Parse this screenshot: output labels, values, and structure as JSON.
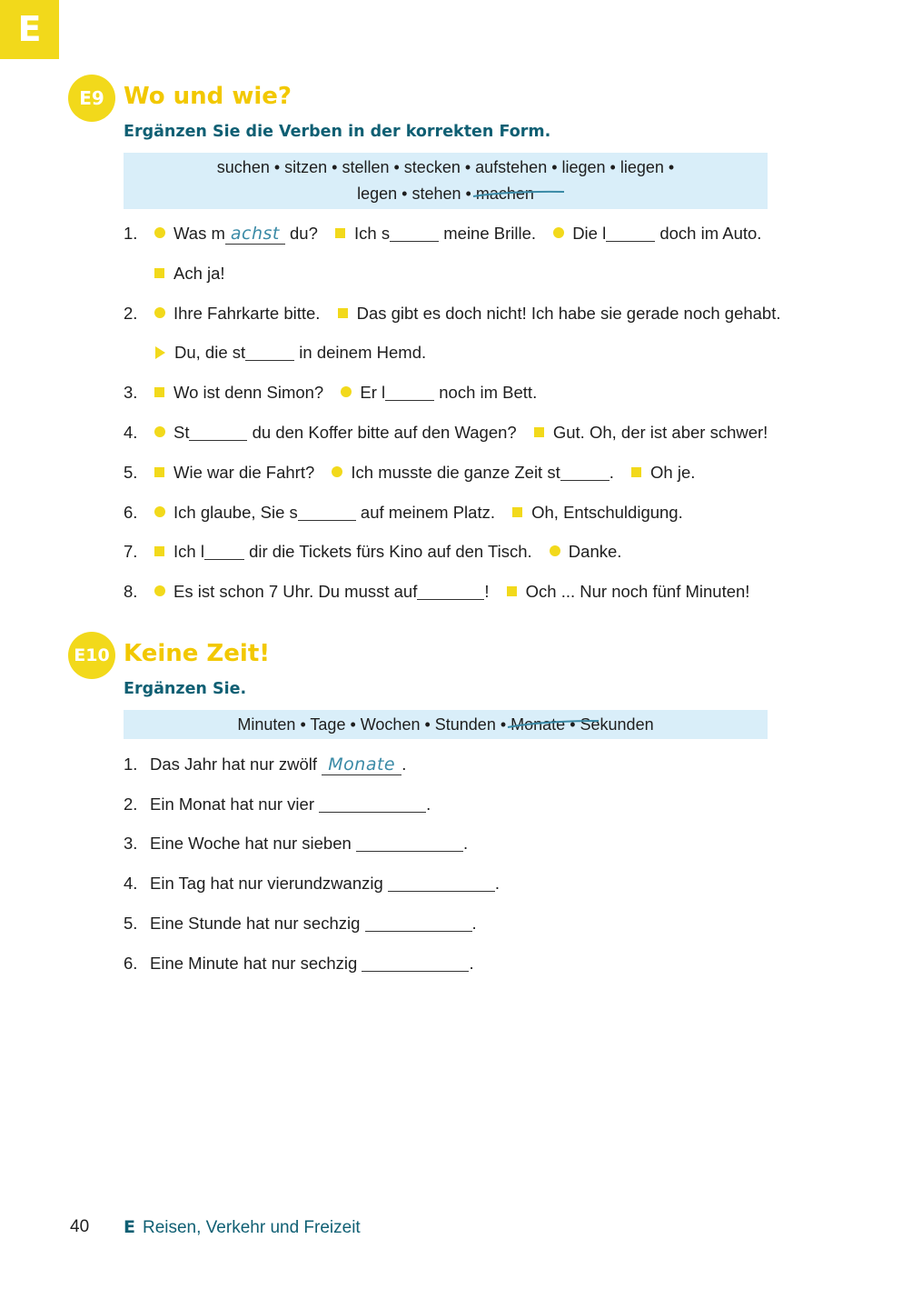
{
  "chapter_letter": "E",
  "e9": {
    "badge": "E9",
    "title": "Wo und wie?",
    "instruction": "Ergänzen Sie die Verben in der korrekten Form.",
    "wordbox_line1": "suchen • sitzen • stellen • stecken • aufstehen • liegen • liegen •",
    "wordbox_line2": "legen • stehen •",
    "wordbox_struck": "machen",
    "items": [
      {
        "num": "1.",
        "a": "Was m",
        "fill": "achst",
        "b": " du?",
        "c": "Ich s",
        "d": " meine Brille.",
        "e": "Die l",
        "f": " doch im Auto."
      },
      {
        "cont": "Ach ja!"
      },
      {
        "num": "2.",
        "a": "Ihre Fahrkarte bitte.",
        "c": "Das gibt es doch nicht! Ich habe sie gerade noch gehabt."
      },
      {
        "a": "Du, die st",
        "b": " in deinem Hemd."
      },
      {
        "num": "3.",
        "a": "Wo ist denn Simon?",
        "c": "Er l",
        "d": " noch im Bett."
      },
      {
        "num": "4.",
        "a": "St",
        "b": " du den Koffer bitte auf den Wagen?",
        "c": "Gut. Oh, der ist aber schwer!"
      },
      {
        "num": "5.",
        "a": "Wie war die Fahrt?",
        "c": "Ich musste die ganze Zeit st",
        "d": ".",
        "e": "Oh je."
      },
      {
        "num": "6.",
        "a": "Ich glaube, Sie s",
        "b": " auf meinem Platz.",
        "c": "Oh, Entschuldigung."
      },
      {
        "num": "7.",
        "a": "Ich l",
        "b": " dir die Tickets fürs Kino auf den Tisch.",
        "c": "Danke."
      },
      {
        "num": "8.",
        "a": "Es ist schon 7 Uhr. Du musst auf",
        "b": "!",
        "c": "Och ... Nur noch fünf Minuten!"
      }
    ]
  },
  "e10": {
    "badge": "E10",
    "title": "Keine Zeit!",
    "instruction": "Ergänzen Sie.",
    "wordbox_before": "Minuten • Tage • Wochen • Stunden •",
    "wordbox_struck": "Monate",
    "wordbox_after": "• Sekunden",
    "items": [
      {
        "num": "1.",
        "text": "Das Jahr hat nur zwölf",
        "fill": "Monate",
        "end": "."
      },
      {
        "num": "2.",
        "text": "Ein Monat hat nur vier",
        "end": "."
      },
      {
        "num": "3.",
        "text": "Eine Woche hat nur sieben",
        "end": "."
      },
      {
        "num": "4.",
        "text": "Ein Tag hat nur vierundzwanzig",
        "end": "."
      },
      {
        "num": "5.",
        "text": "Eine Stunde hat nur sechzig",
        "end": "."
      },
      {
        "num": "6.",
        "text": "Eine Minute hat nur sechzig",
        "end": "."
      }
    ]
  },
  "footer": {
    "page_number": "40",
    "section_letter": "E",
    "section_title": "Reisen, Verkehr und Freizeit"
  },
  "colors": {
    "accent_yellow": "#f2d91b",
    "heading_teal": "#0f5f73",
    "wordbox_blue": "#d9eef9",
    "handwriting": "#3a8aa6"
  }
}
